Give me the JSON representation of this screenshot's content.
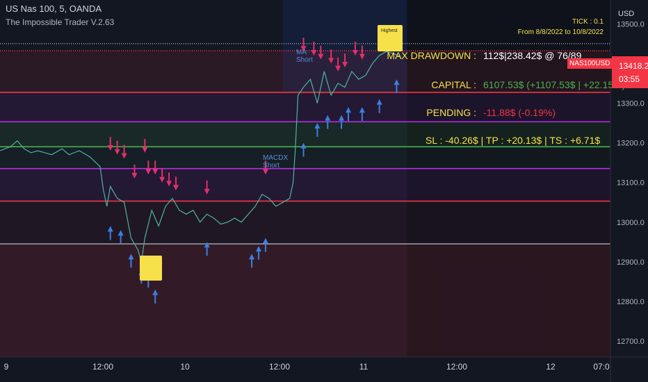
{
  "header": {
    "symbol_line": "US Nas 100, 5, OANDA",
    "indicator_name": "The Impossible Trader V.2.63"
  },
  "info": {
    "tick": "TICK : 0.1",
    "date_range": "From 8/8/2022 to 10/8/2022"
  },
  "stats": {
    "max_drawdown_label": "MAX DRAWDOWN :",
    "max_drawdown_value": "112$|238.42$ @ 76/89",
    "capital_label": "CAPITAL :",
    "capital_value": "6107.53$ (+1107.53$ | +22.15%)",
    "pending_label": "PENDING :",
    "pending_value": "-11.88$ (-0.19%)",
    "sl_tp_ts": "SL : -40.26$ |   TP : +20.13$ | TS : +6.71$"
  },
  "price_scale": {
    "currency": "USD",
    "current_price": "13418.2",
    "countdown": "03:55",
    "symbol_tag": "NAS100USD"
  },
  "annotations": {
    "short_label_1": "MA Short",
    "short_label_2": "MACDX Short",
    "highest_tag": "Highest"
  },
  "colors": {
    "background": "#131722",
    "price_line": "#4fb3a3",
    "buy_arrow": "#3d7ee0",
    "sell_arrow": "#e52e6b",
    "red_band": "#f23645",
    "magenta_band": "#b52ee0",
    "green_band": "#4caf50",
    "accent_yellow": "#f7e14b"
  },
  "chart_data": {
    "type": "line",
    "x_ticks": [
      "9",
      "12:00",
      "10",
      "12:00",
      "11",
      "12:00",
      "12",
      "07:0"
    ],
    "y_ticks": [
      13500,
      13400,
      13300,
      13200,
      13100,
      13000,
      12900,
      12800,
      12700
    ],
    "y_tick_labels": [
      "13500.0",
      "13400.0",
      "13300.0",
      "13200.0",
      "13100.0",
      "13000.0",
      "12900.0",
      "12800.0",
      "12700.0"
    ],
    "ylim": [
      12660,
      13560
    ],
    "xlim": [
      0,
      885
    ],
    "series": [
      {
        "x": [
          0,
          15,
          25,
          35,
          45,
          55,
          65,
          75,
          90,
          100,
          115,
          130,
          145,
          150,
          155,
          160,
          170,
          180,
          190,
          200,
          205,
          210,
          220,
          230,
          240,
          250,
          260,
          270,
          280,
          290,
          300,
          310,
          320,
          330,
          340,
          350,
          360,
          370,
          380,
          390,
          400,
          410,
          420,
          425,
          428,
          432,
          440,
          450,
          460,
          470,
          480,
          490,
          500,
          510,
          520,
          530,
          540,
          550,
          560,
          570,
          580
        ],
        "y": [
          13180,
          13190,
          13205,
          13185,
          13175,
          13180,
          13175,
          13170,
          13185,
          13170,
          13180,
          13165,
          13140,
          13080,
          13040,
          13090,
          13060,
          13050,
          12960,
          12930,
          12900,
          12960,
          13030,
          12990,
          13040,
          13060,
          13030,
          13020,
          13030,
          13000,
          13020,
          13010,
          12995,
          13000,
          13010,
          13000,
          13020,
          13040,
          13070,
          13060,
          13040,
          13050,
          13060,
          13100,
          13180,
          13320,
          13340,
          13360,
          13300,
          13380,
          13320,
          13350,
          13340,
          13380,
          13360,
          13370,
          13400,
          13420,
          13430,
          13425,
          13418
        ]
      }
    ],
    "hlines": [
      {
        "y": 13450,
        "color": "#9598a1",
        "kind": "dotted"
      },
      {
        "y": 13432,
        "color": "#f23645",
        "kind": "dotted"
      },
      {
        "y": 13327,
        "color": "#f23645",
        "kind": "solid"
      },
      {
        "y": 13253,
        "color": "#b52ee0",
        "kind": "solid"
      },
      {
        "y": 13190,
        "color": "#4caf50",
        "kind": "solid"
      },
      {
        "y": 13135,
        "color": "#b52ee0",
        "kind": "solid"
      },
      {
        "y": 13053,
        "color": "#f23645",
        "kind": "solid"
      },
      {
        "y": 12945,
        "color": "#9598a1",
        "kind": "solid"
      }
    ],
    "sell_arrows_x": [
      160,
      170,
      180,
      195,
      210,
      215,
      225,
      235,
      245,
      255,
      300,
      385,
      440,
      455,
      465,
      480,
      490,
      500,
      515,
      525,
      565,
      580
    ],
    "sell_arrows_y": [
      13180,
      13170,
      13160,
      13110,
      13175,
      13120,
      13120,
      13100,
      13090,
      13080,
      13070,
      13120,
      13430,
      13420,
      13410,
      13400,
      13380,
      13390,
      13420,
      13410,
      13460,
      13440
    ],
    "buy_arrows_x": [
      160,
      175,
      190,
      205,
      215,
      225,
      300,
      365,
      375,
      385,
      440,
      460,
      475,
      495,
      505,
      525,
      550,
      575
    ],
    "buy_arrows_y": [
      12990,
      12980,
      12920,
      12880,
      12870,
      12830,
      12950,
      12920,
      12940,
      12960,
      13200,
      13250,
      13270,
      13270,
      13290,
      13290,
      13310,
      13360
    ]
  }
}
